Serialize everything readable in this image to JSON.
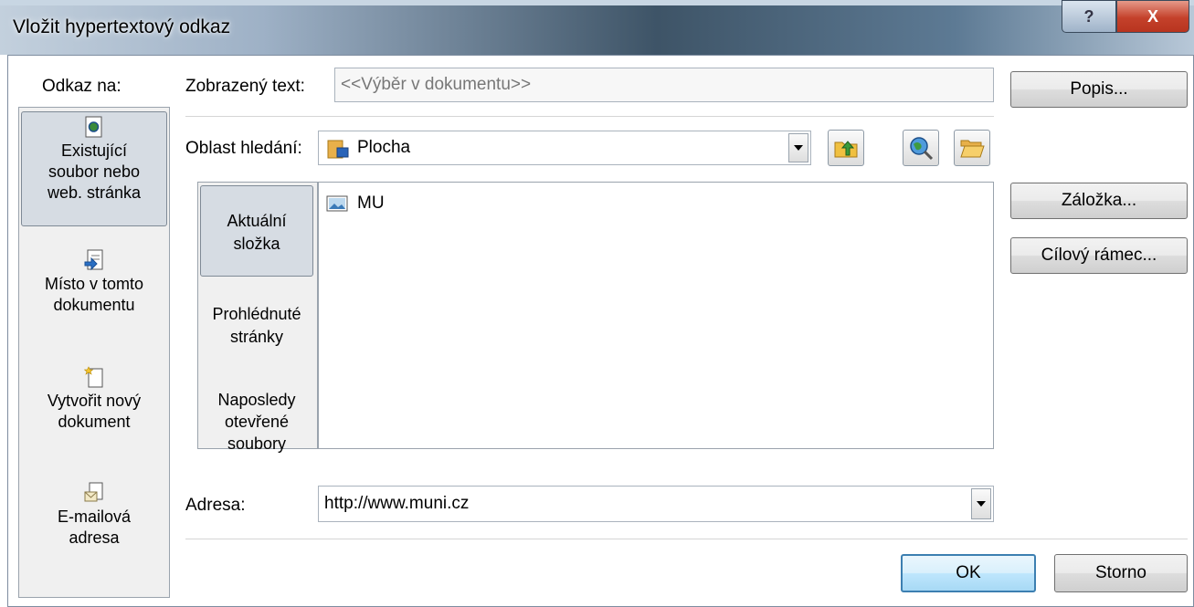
{
  "window": {
    "title": "Vložit hypertextový odkaz",
    "help_label": "?",
    "close_label": "X"
  },
  "sidebar": {
    "heading": "Odkaz na:",
    "items": [
      {
        "line1": "Existující",
        "line2": "soubor nebo",
        "line3": "web. stránka",
        "icon": "web-page-icon",
        "selected": true
      },
      {
        "line1": "Místo v tomto",
        "line2": "dokumentu",
        "icon": "place-in-document-icon",
        "selected": false
      },
      {
        "line1": "Vytvořit nový",
        "line2": "dokument",
        "icon": "new-document-icon",
        "selected": false
      },
      {
        "line1": "E-mailová",
        "line2": "adresa",
        "icon": "email-icon",
        "selected": false
      }
    ]
  },
  "shown_text": {
    "label": "Zobrazený text:",
    "value": "<<Výběr v dokumentu>>"
  },
  "look_in": {
    "label": "Oblast hledání:",
    "value": "Plocha"
  },
  "places": [
    {
      "line1": "Aktuální",
      "line2": "složka",
      "selected": true
    },
    {
      "line1": "Prohlédnuté",
      "line2": "stránky",
      "selected": false
    },
    {
      "line1": "Naposledy",
      "line2": "otevřené",
      "line3": "soubory",
      "selected": false
    }
  ],
  "files": [
    {
      "name": "MU",
      "icon": "image-file-icon"
    }
  ],
  "address": {
    "label": "Adresa:",
    "value": "http://www.muni.cz"
  },
  "buttons": {
    "screentip": "Popis...",
    "bookmark": "Záložka...",
    "target_frame": "Cílový rámec...",
    "ok": "OK",
    "cancel": "Storno"
  },
  "colors": {
    "title_dark": "#3e5467",
    "close_red": "#c4412b",
    "ok_border": "#3c7fb1"
  }
}
